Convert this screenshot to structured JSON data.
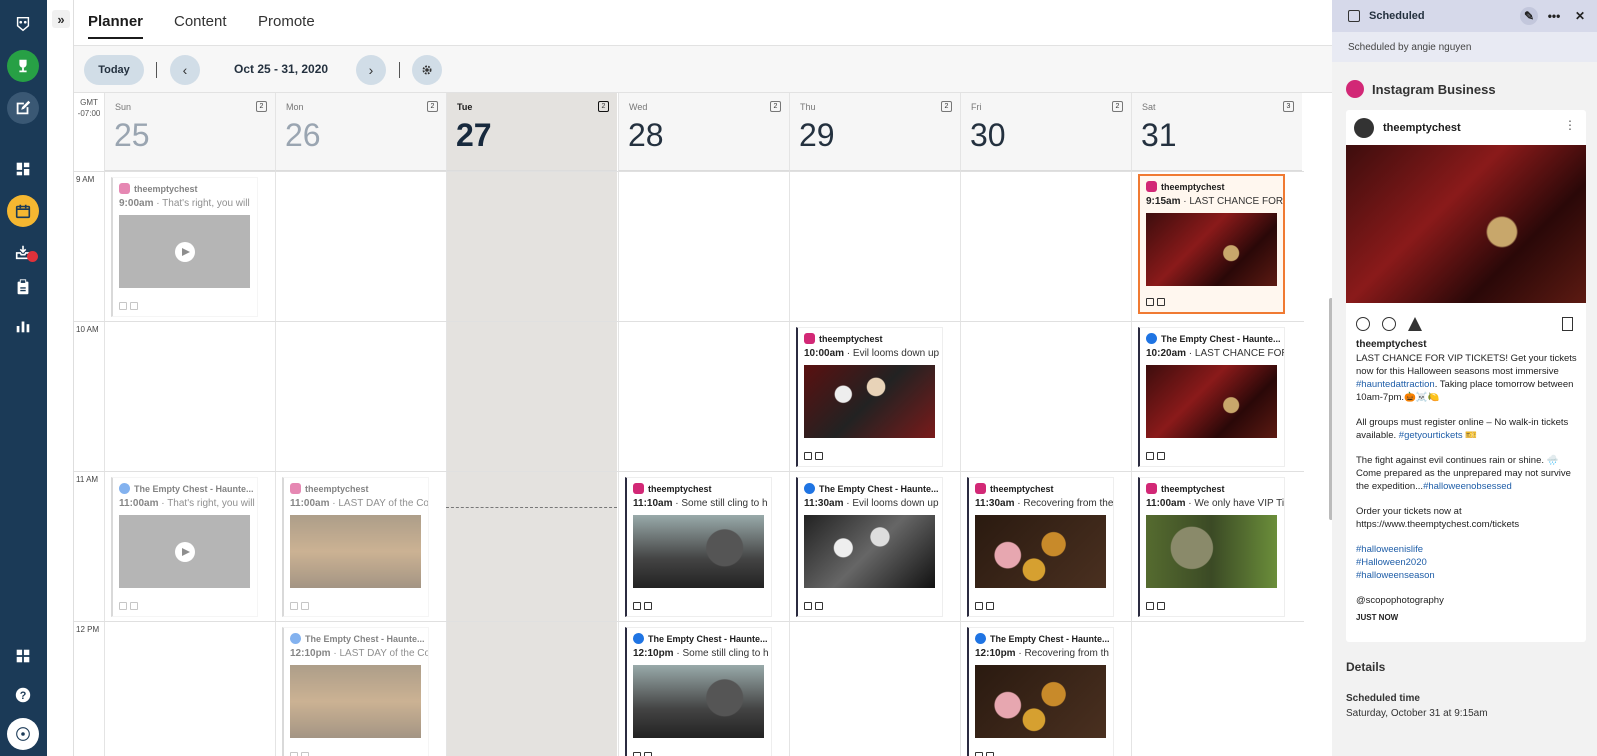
{
  "nav": {
    "items": [
      "owl-logo",
      "trophy",
      "compose",
      "dashboard",
      "planner",
      "inbox",
      "assignments",
      "analytics"
    ],
    "bottom": [
      "apps",
      "help",
      "profile"
    ],
    "active": "planner",
    "accent": "#f5b731",
    "notification_color": "#e0313a"
  },
  "topnav": {
    "tabs": [
      {
        "label": "Planner",
        "active": true
      },
      {
        "label": "Content",
        "active": false
      },
      {
        "label": "Promote",
        "active": false
      }
    ]
  },
  "toolbar": {
    "today_label": "Today",
    "range": "Oct 25 - 31, 2020"
  },
  "calendar": {
    "timezone": "GMT -07:00",
    "days": [
      {
        "name": "Sun",
        "num": "25",
        "count": "2",
        "state": "past"
      },
      {
        "name": "Mon",
        "num": "26",
        "count": "2",
        "state": "past"
      },
      {
        "name": "Tue",
        "num": "27",
        "count": "2",
        "state": "today"
      },
      {
        "name": "Wed",
        "num": "28",
        "count": "2",
        "state": "future"
      },
      {
        "name": "Thu",
        "num": "29",
        "count": "2",
        "state": "future"
      },
      {
        "name": "Fri",
        "num": "30",
        "count": "2",
        "state": "future"
      },
      {
        "name": "Sat",
        "num": "31",
        "count": "3",
        "state": "future"
      }
    ],
    "hours": [
      "9 AM",
      "10 AM",
      "11 AM",
      "12 PM"
    ],
    "posts": [
      {
        "day": 0,
        "hour": 0,
        "network": "ig",
        "account": "theemptychest",
        "time": "9:00am",
        "text": " · That's right, you will",
        "thumb": "vid",
        "past": true
      },
      {
        "day": 6,
        "hour": 0,
        "network": "ig",
        "account": "theemptychest",
        "time": "9:15am",
        "text": " · LAST CHANCE FOR VIP",
        "thumb": "t-skull",
        "selected": true
      },
      {
        "day": 4,
        "hour": 1,
        "network": "ig",
        "account": "theemptychest",
        "time": "10:00am",
        "text": " · Evil looms down up",
        "thumb": "t-witch"
      },
      {
        "day": 6,
        "hour": 1,
        "network": "fb",
        "account": "The Empty Chest - Haunte...",
        "time": "10:20am",
        "text": " · LAST CHANCE FOR VIP",
        "thumb": "t-skull"
      },
      {
        "day": 0,
        "hour": 2,
        "network": "fb",
        "account": "The Empty Chest - Haunte...",
        "time": "11:00am",
        "text": " · That's right, you will",
        "thumb": "vid",
        "past": true
      },
      {
        "day": 1,
        "hour": 2,
        "network": "ig",
        "account": "theemptychest",
        "time": "11:00am",
        "text": " · LAST DAY of the Cor",
        "thumb": "t-game",
        "past": true
      },
      {
        "day": 3,
        "hour": 2,
        "network": "ig",
        "account": "theemptychest",
        "time": "11:10am",
        "text": " · Some still cling to h",
        "thumb": "t-wolf"
      },
      {
        "day": 4,
        "hour": 2,
        "network": "fb",
        "account": "The Empty Chest - Haunte...",
        "time": "11:30am",
        "text": " · Evil looms down up",
        "thumb": "t-witchbw"
      },
      {
        "day": 5,
        "hour": 2,
        "network": "ig",
        "account": "theemptychest",
        "time": "11:30am",
        "text": " · Recovering from the",
        "thumb": "t-beer"
      },
      {
        "day": 6,
        "hour": 2,
        "network": "ig",
        "account": "theemptychest",
        "time": "11:00am",
        "text": " · We only have VIP Ti",
        "thumb": "t-statue"
      },
      {
        "day": 1,
        "hour": 3,
        "network": "fb",
        "account": "The Empty Chest - Haunte...",
        "time": "12:10pm",
        "text": " · LAST DAY of the Cor",
        "thumb": "t-game",
        "past": true
      },
      {
        "day": 3,
        "hour": 3,
        "network": "fb",
        "account": "The Empty Chest - Haunte...",
        "time": "12:10pm",
        "text": " · Some still cling to h",
        "thumb": "t-wolf"
      },
      {
        "day": 5,
        "hour": 3,
        "network": "fb",
        "account": "The Empty Chest - Haunte...",
        "time": "12:10pm",
        "text": " · Recovering from th",
        "thumb": "t-beer"
      }
    ]
  },
  "panel": {
    "status": "Scheduled",
    "scheduled_by": "Scheduled by angie nguyen",
    "network": "Instagram Business",
    "account": "theemptychest",
    "caption": {
      "username": "theemptychest",
      "p1a": "LAST CHANCE FOR VIP TICKETS! Get your tickets now for this Halloween seasons most immersive ",
      "p1tag": "#hauntedattraction",
      "p1b": ". Taking place tomorrow between 10am-7pm.🎃☠️🍋",
      "p2a": "All groups must register online – No walk-in tickets available. ",
      "p2tag": "#getyourtickets",
      "p2b": " 🎫",
      "p3a": "The fight against evil continues rain or shine. 🌧️ Come prepared as the unprepared may not survive the expedition...",
      "p3tag": "#halloweenobsessed",
      "p4a": "Order your tickets now at",
      "p4b": "https://www.theemptychest.com/tickets",
      "tags": [
        "#halloweenislife",
        "#Halloween2020",
        "#halloweenseason"
      ],
      "credit": "@scopophotography",
      "when": "JUST NOW"
    },
    "details_title": "Details",
    "scheduled_time_label": "Scheduled time",
    "scheduled_time_value": "Saturday, October 31 at 9:15am"
  }
}
